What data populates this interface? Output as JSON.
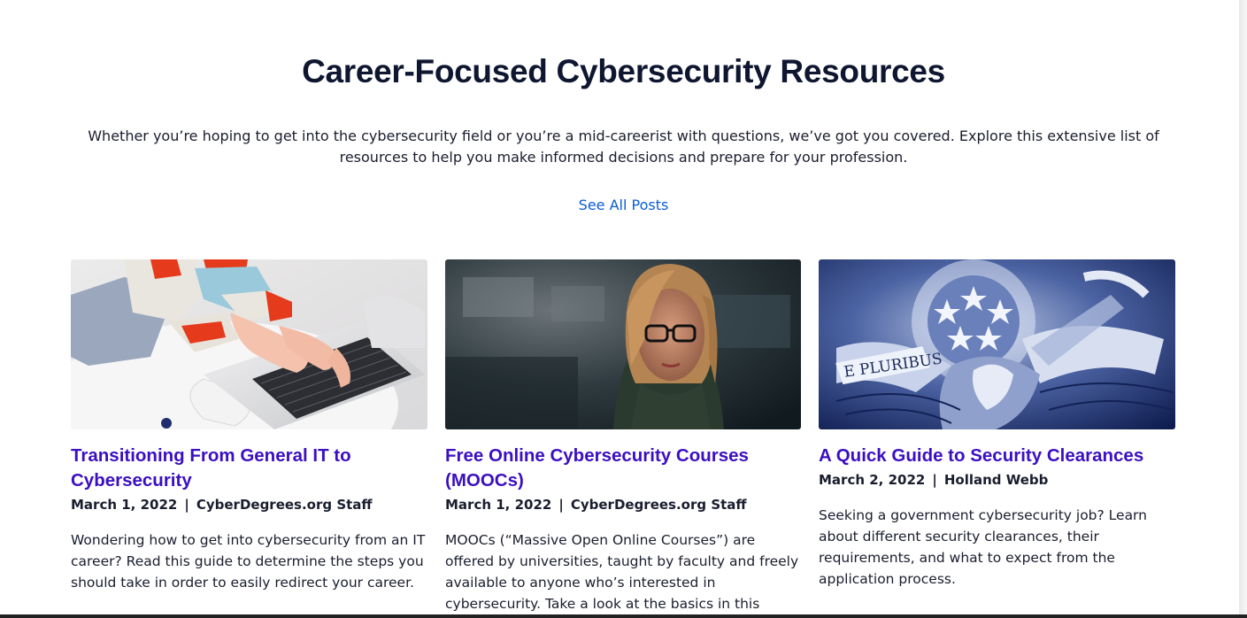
{
  "section": {
    "title": "Career-Focused Cybersecurity Resources",
    "intro": "Whether you’re hoping to get into the cybersecurity field or you’re a mid-careerist with questions, we’ve got you covered. Explore this extensive list of resources to help you make informed decisions and prepare for your profession.",
    "see_all_label": "See All Posts"
  },
  "cards": [
    {
      "title": "Transitioning From General IT to Cybersecurity",
      "date": "March 1, 2022",
      "separator": "|",
      "author": "CyberDegrees.org Staff",
      "excerpt": "Wondering how to get into cybersecurity from an IT career? Read this guide to determine the steps you should take in order to easily redirect your career.",
      "image": "laptop-typing-image"
    },
    {
      "title": "Free Online Cybersecurity Courses (MOOCs)",
      "date": "March 1, 2022",
      "separator": "|",
      "author": "CyberDegrees.org Staff",
      "excerpt": "MOOCs (“Massive Open Online Courses”) are offered by universities, taught by faculty and freely available to anyone who’s interested in cybersecurity. Take a look at the basics in this guide.",
      "image": "woman-at-screen-image"
    },
    {
      "title": "A Quick Guide to Security Clearances",
      "date": "March 2, 2022",
      "separator": "|",
      "author": "Holland Webb",
      "excerpt": "Seeking a government cybersecurity job? Learn about different security clearances, their requirements, and what to expect from the application process.",
      "image": "eagle-seal-image",
      "image_text": "E PLURIBUS"
    }
  ],
  "colors": {
    "title": "#0e1630",
    "link": "#0a5cd5",
    "card_title": "#3b0fc2",
    "text": "#1a1d2e"
  }
}
